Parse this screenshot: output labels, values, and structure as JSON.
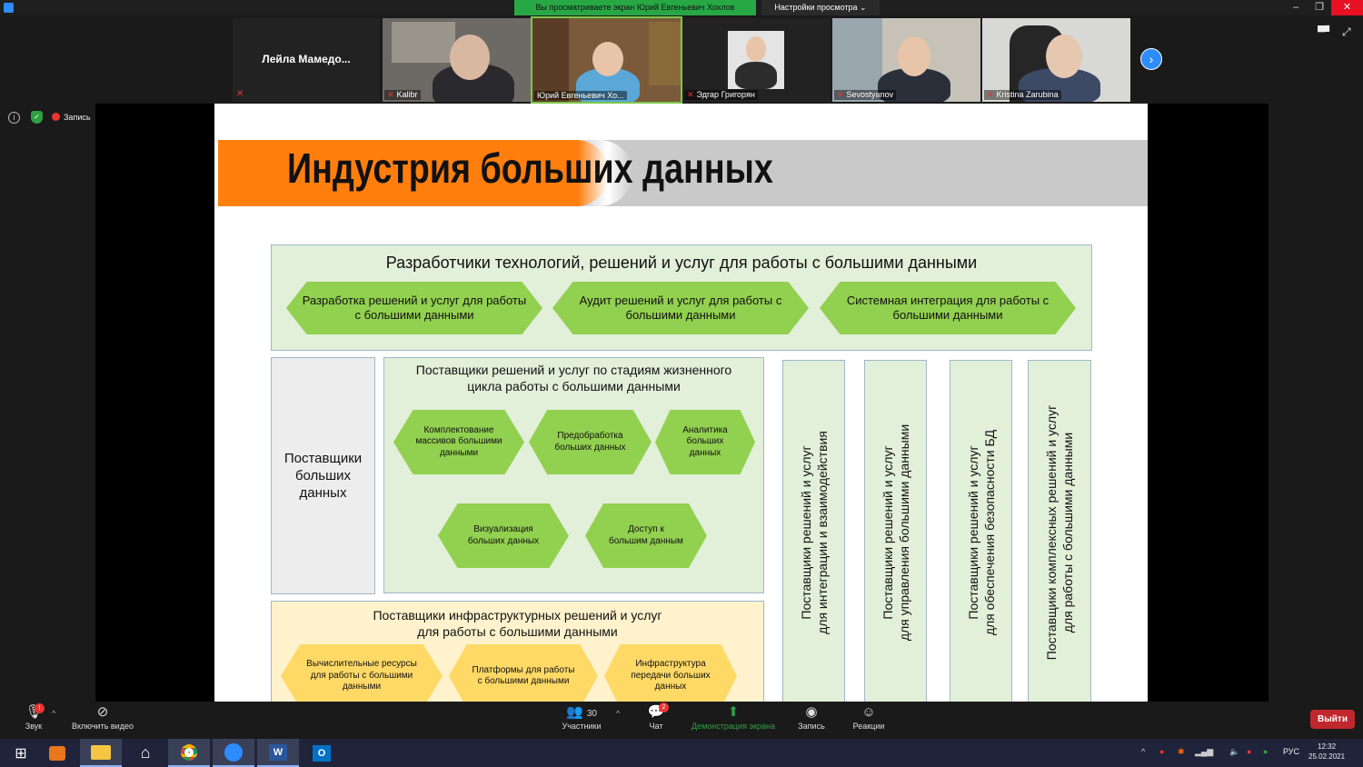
{
  "window": {
    "share_banner": "Вы просматриваете экран Юрий Евгеньевич Хохлов",
    "view_options": "Настройки просмотра ⌄"
  },
  "participants": [
    {
      "name": "Лейла  Мамедо..."
    },
    {
      "name": "Kalibr"
    },
    {
      "name": "Юрий Евгеньевич Хо..."
    },
    {
      "name": "Эдгар Григорян"
    },
    {
      "name": "Sevostyanov"
    },
    {
      "name": "Kristina Zarubina"
    }
  ],
  "recording_label": "Запись",
  "slide": {
    "title": "Индустрия больших данных",
    "developers": {
      "title": "Разработчики технологий, решений и услуг для работы с большими данными",
      "items": [
        "Разработка решений и услуг для работы с большими данными",
        "Аудит решений и услуг для работы с большими данными",
        "Системная интеграция для работы с большими данными"
      ]
    },
    "data_providers": "Поставщики больших данных",
    "lifecycle": {
      "title": "Поставщики решений и услуг по стадиям жизненного цикла работы с большими данными",
      "items": [
        "Комплектование массивов большими данными",
        "Предобработка больших данных",
        "Аналитика больших данных",
        "Визуализация больших данных",
        "Доступ к большим данным"
      ]
    },
    "infrastructure": {
      "title_line1": "Поставщики инфраструктурных решений и услуг",
      "title_line2": "для работы с большими данными",
      "items": [
        "Вычислительные ресурсы для работы с большими данными",
        "Платформы для работы с большими данными",
        "Инфраструктура передачи больших данных"
      ]
    },
    "vertical": [
      {
        "line1": "Поставщики решений и услуг",
        "line2": "для интеграции и взаимодействия"
      },
      {
        "line1": "Поставщики решений и услуг",
        "line2": "для управления большими данными"
      },
      {
        "line1": "Поставщики решений и услуг",
        "line2": "для обеспечения безопасности БД"
      },
      {
        "line1": "Поставщики комплексных решений и услуг",
        "line2": "для работы с большими данными"
      }
    ]
  },
  "toolbar": {
    "audio": "Звук",
    "video": "Включить видео",
    "participants": "Участники",
    "participants_count": "30",
    "chat": "Чат",
    "chat_badge": "2",
    "share": "Демонстрация экрана",
    "record": "Запись",
    "reactions": "Реакции",
    "exit": "Выйти"
  },
  "taskbar": {
    "lang": "РУС",
    "time": "12:32",
    "date": "25.02.2021"
  },
  "colors": {
    "orange": "#ff7f0e",
    "green_box": "#e2efd9",
    "green_hex": "#92d050",
    "yellow_box": "#fff2cc",
    "yellow_hex": "#ffd966",
    "share_green": "#28a745"
  }
}
